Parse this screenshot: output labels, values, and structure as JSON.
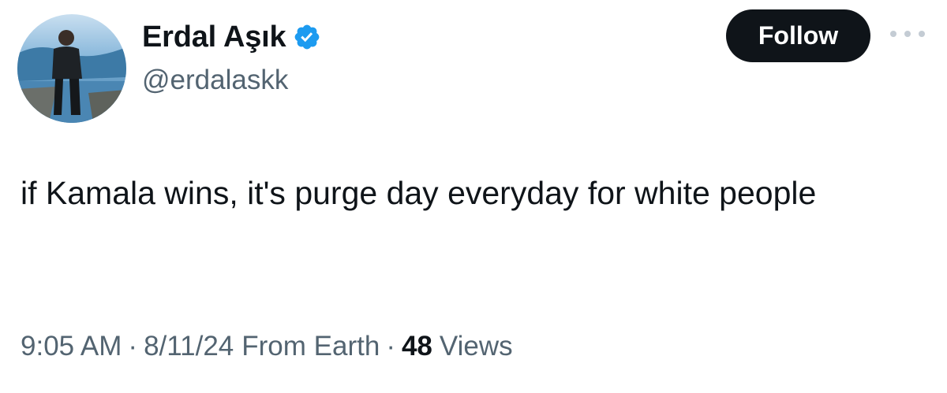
{
  "author": {
    "display_name": "Erdal Aşık",
    "handle": "@erdalaskk",
    "verified": true,
    "avatar_icon": "profile-photo-man-standing-by-water"
  },
  "actions": {
    "follow_label": "Follow",
    "more_icon": "more-horizontal-icon"
  },
  "tweet": {
    "text": "if Kamala wins, it's purge day everyday for white people"
  },
  "meta": {
    "time": "9:05 AM",
    "separator": "·",
    "date": "8/11/24",
    "source": "From Earth",
    "views_count": "48",
    "views_label": "Views"
  },
  "colors": {
    "text_primary": "#0f1419",
    "text_secondary": "#536471",
    "verified_blue": "#1d9bf0",
    "follow_button_bg": "#0f1419"
  }
}
